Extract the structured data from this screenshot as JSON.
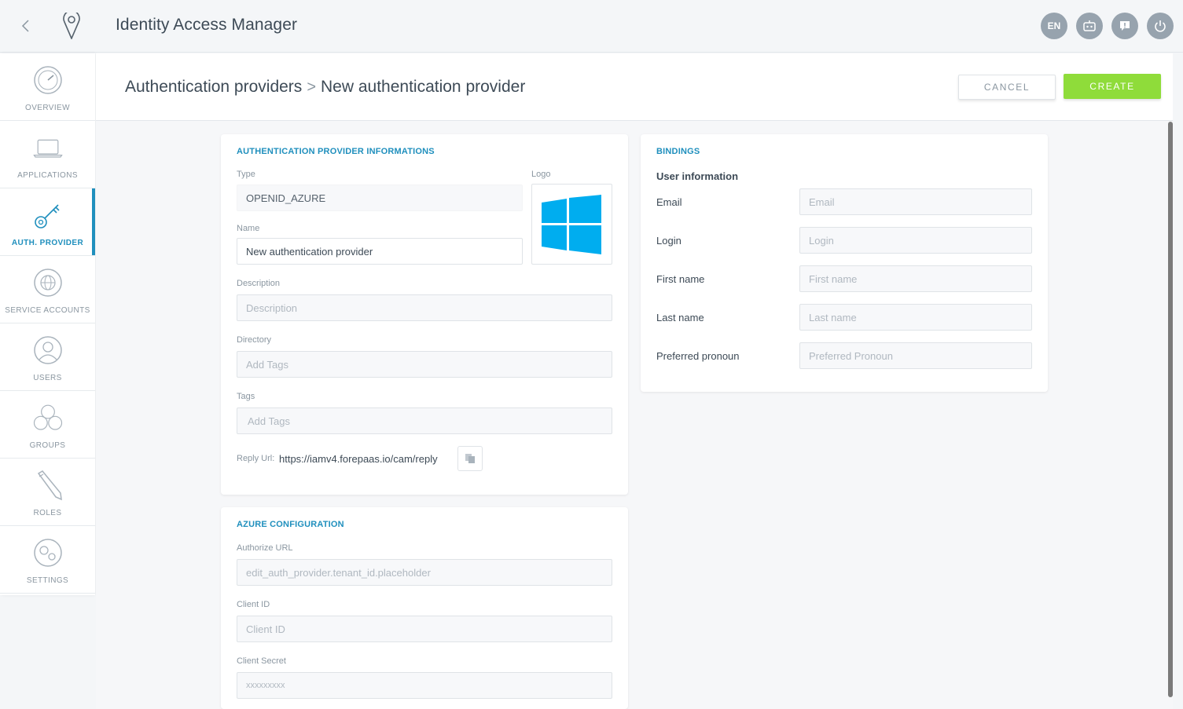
{
  "app": {
    "title": "Identity Access Manager"
  },
  "topbar": {
    "language": "EN"
  },
  "sidebar": {
    "items": [
      {
        "label": "OVERVIEW",
        "icon": "gauge-icon"
      },
      {
        "label": "APPLICATIONS",
        "icon": "laptop-icon"
      },
      {
        "label": "AUTH. PROVIDER",
        "icon": "key-icon",
        "active": true
      },
      {
        "label": "SERVICE ACCOUNTS",
        "icon": "service-accounts-icon"
      },
      {
        "label": "USERS",
        "icon": "user-icon"
      },
      {
        "label": "GROUPS",
        "icon": "group-icon"
      },
      {
        "label": "ROLES",
        "icon": "pencil-icon"
      },
      {
        "label": "SETTINGS",
        "icon": "gears-icon"
      }
    ]
  },
  "header": {
    "breadcrumb_parent": "Authentication providers",
    "breadcrumb_sep": ">",
    "breadcrumb_current": "New authentication provider",
    "cancel_label": "CANCEL",
    "create_label": "CREATE"
  },
  "provider_card": {
    "title": "AUTHENTICATION PROVIDER INFORMATIONS",
    "type_label": "Type",
    "type_value": "OPENID_AZURE",
    "logo_label": "Logo",
    "name_label": "Name",
    "name_value": "New authentication provider",
    "description_label": "Description",
    "description_placeholder": "Description",
    "directory_label": "Directory",
    "directory_placeholder": "Add Tags",
    "tags_label": "Tags",
    "tags_placeholder": "Add Tags",
    "reply_label": "Reply Url:",
    "reply_value": "https://iamv4.forepaas.io/cam/reply"
  },
  "azure_card": {
    "title": "AZURE CONFIGURATION",
    "authorize_label": "Authorize URL",
    "authorize_placeholder": "edit_auth_provider.tenant_id.placeholder",
    "client_id_label": "Client ID",
    "client_id_placeholder": "Client ID",
    "client_secret_label": "Client Secret",
    "client_secret_placeholder": "xxxxxxxxx"
  },
  "bindings_card": {
    "title": "BINDINGS",
    "subtitle": "User information",
    "fields": [
      {
        "label": "Email",
        "placeholder": "Email"
      },
      {
        "label": "Login",
        "placeholder": "Login"
      },
      {
        "label": "First name",
        "placeholder": "First name"
      },
      {
        "label": "Last name",
        "placeholder": "Last name"
      },
      {
        "label": "Preferred pronoun",
        "placeholder": "Preferred Pronoun"
      }
    ]
  },
  "colors": {
    "accent": "#1f8fbd",
    "create": "#8fdc3a",
    "windows_logo": "#00adef",
    "topbar_button": "#97a3ae"
  }
}
